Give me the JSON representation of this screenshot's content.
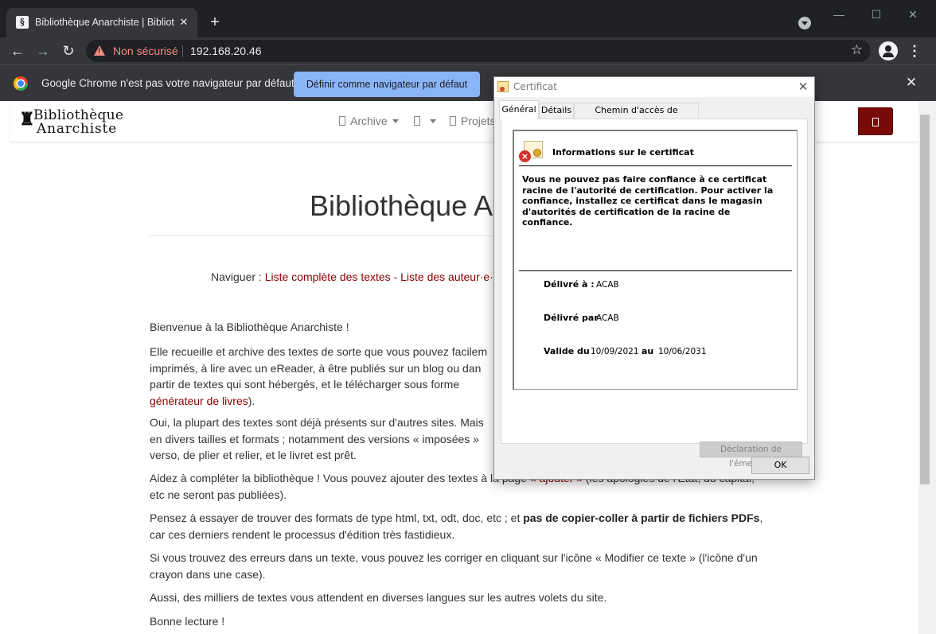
{
  "browser": {
    "tab_title": "Bibliothèque Anarchiste | Biblioth",
    "tab_close": "✕",
    "new_tab": "+",
    "window_min": "—",
    "window_max": "☐",
    "window_close": "✕",
    "nav_back": "←",
    "nav_forward": "→",
    "nav_reload": "↻",
    "security_label": "Non sécurisé",
    "url": "192.168.20.46",
    "bookmark_star": "☆",
    "menu_dots": "⋮"
  },
  "infobar": {
    "message": "Google Chrome n'est pas votre navigateur par défaut",
    "button_label": "Définir comme navigateur par défaut",
    "close": "✕"
  },
  "site": {
    "logo_line1": "Bibliothèque",
    "logo_line2": "Anarchiste",
    "nav": {
      "archive_label": "Archive",
      "projects_label": "Projets"
    },
    "title": "Bibliothèque A",
    "browse_prefix": "Naviguer : ",
    "browse_links": "Liste complète des textes - Liste des auteur·e·",
    "paragraphs": {
      "p1": "Bienvenue à la Bibliothèque Anarchiste !",
      "p2_line1": "Elle recueille et archive des textes de sorte que vous pouvez facilem",
      "p2_line2": "imprimés, à lire avec un eReader, à être publiés sur un blog ou dan",
      "p2_line3": "partir de textes qui sont hébergés, et le télécharger sous forme",
      "p2_link": "générateur de livres",
      "p2_tail": ").",
      "p3_line1": "Oui, la plupart des textes sont déjà présents sur d'autres sites. Mais",
      "p3_line2": "en divers tailles et formats ; notamment des versions « imposées »",
      "p3_line3": "verso, de plier et relier, et le livret est prêt.",
      "p4_a": "Aidez à compléter la bibliothèque ! Vous pouvez ajouter des textes à la page ",
      "p4_link": "« ajouter »",
      "p4_b": " (les apologies de l'Etat, du capital,",
      "p4_line2": "etc ne seront pas publiées).",
      "p5_a": "Pensez à essayer de trouver des formats de type html, txt, odt, doc, etc ; et ",
      "p5_bold": "pas de copier-coller à partir de fichiers PDFs",
      "p5_b": ",",
      "p5_line2": "car ces derniers rendent le processus d'édition très fastidieux.",
      "p6_line1": "Si vous trouvez des erreurs dans un texte, vous pouvez les corriger en cliquant sur l'icône « Modifier ce texte » (l'icône d'un",
      "p6_line2": "crayon dans une case).",
      "p7": "Aussi, des milliers de textes vous attendent en diverses langues sur les autres volets du site.",
      "p8": "Bonne lecture !"
    }
  },
  "dialog": {
    "title": "Certificat",
    "close": "✕",
    "tabs": [
      "Général",
      "Détails",
      "Chemin d'accès de certification"
    ],
    "info_heading": "Informations sur le certificat",
    "warning": "Vous ne pouvez pas faire confiance à ce certificat racine de l'autorité de certification. Pour activer la confiance, installez ce certificat dans le magasin d'autorités de certification de la racine de confiance.",
    "issued_to_label": "Délivré à :",
    "issued_to": "ACAB",
    "issued_by_label": "Délivré par",
    "issued_by": "ACAB",
    "valid_from_label": "Valide du",
    "valid_from": "10/09/2021",
    "valid_to_label": "au",
    "valid_to": "10/06/2031",
    "issuer_statement_button": "Déclaration de l'émetteur",
    "ok_button": "OK"
  },
  "colors": {
    "chrome_dark": "#202124",
    "chrome_toolbar": "#35363a",
    "insecure_red": "#f28b82",
    "infobar_button": "#8ab4f8",
    "site_link": "#8b0000",
    "search_button": "#7a0a0a"
  }
}
